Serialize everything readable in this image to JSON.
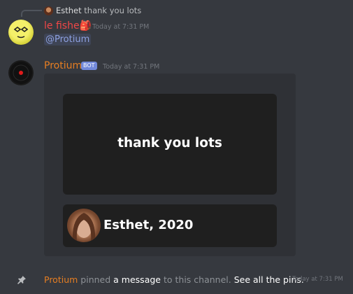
{
  "reply": {
    "author": "Esthet",
    "text": "thank you lots",
    "avatar_icon": "reply-avatar"
  },
  "message1": {
    "author": "le fishe",
    "author_emoji": "🎒",
    "timestamp": "Today at 7:31 PM",
    "mention": "@Protium",
    "author_color": "#f04747"
  },
  "message2": {
    "author": "Protium",
    "bot_tag": "BOT",
    "timestamp": "Today at 7:31 PM",
    "author_color": "#e67e22",
    "embed": {
      "quote": "thank you lots",
      "attribution": "Esthet, 2020"
    }
  },
  "pin_message": {
    "author": "Protium",
    "text_pinned": "pinned",
    "link_message": "a message",
    "text_to_channel": "to this channel.",
    "link_see_pins": "See all the pins.",
    "timestamp": "Today at 7:31 PM",
    "icon": "pin-icon"
  },
  "colors": {
    "background": "#36393f",
    "embed_background": "#2f3136",
    "card_background": "#1f1f1f",
    "mention": "#8ea1e1",
    "bot_tag": "#7289da"
  }
}
